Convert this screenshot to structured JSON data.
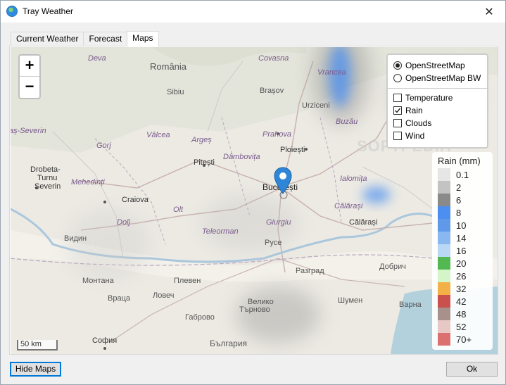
{
  "window": {
    "title": "Tray Weather",
    "close": "✕"
  },
  "icons": {
    "app": "globe-icon",
    "close": "close-icon",
    "pin": "map-pin-icon"
  },
  "tabs": [
    {
      "label": "Current Weather",
      "active": false
    },
    {
      "label": "Forecast",
      "active": false
    },
    {
      "label": "Maps",
      "active": true
    }
  ],
  "zoom": {
    "in": "+",
    "out": "−"
  },
  "layers": {
    "base": [
      {
        "label": "OpenStreetMap",
        "selected": true
      },
      {
        "label": "OpenStreetMap BW",
        "selected": false
      }
    ],
    "overlays": [
      {
        "label": "Temperature",
        "checked": false
      },
      {
        "label": "Rain",
        "checked": true
      },
      {
        "label": "Clouds",
        "checked": false
      },
      {
        "label": "Wind",
        "checked": false
      }
    ]
  },
  "legend": {
    "title": "Rain (mm)",
    "items": [
      {
        "label": "0.1",
        "color": "#e6e6e6"
      },
      {
        "label": "2",
        "color": "#c3c3c3"
      },
      {
        "label": "6",
        "color": "#8a8a8a"
      },
      {
        "label": "8",
        "color": "#4c8ff0"
      },
      {
        "label": "10",
        "color": "#5f99e8"
      },
      {
        "label": "14",
        "color": "#89b8f0"
      },
      {
        "label": "16",
        "color": "#b8d8f5"
      },
      {
        "label": "20",
        "color": "#54b852"
      },
      {
        "label": "26",
        "color": "#d4f5c8"
      },
      {
        "label": "32",
        "color": "#f2b046"
      },
      {
        "label": "42",
        "color": "#c9504d"
      },
      {
        "label": "48",
        "color": "#a8918a"
      },
      {
        "label": "52",
        "color": "#e8c8c5"
      },
      {
        "label": "70+",
        "color": "#dc6f70"
      }
    ]
  },
  "scale": "50 km",
  "map_labels": [
    {
      "text": "Deva",
      "color": "#7a5a8e",
      "italic": true
    },
    {
      "text": "Covasna",
      "color": "#7a5a8e",
      "italic": true
    },
    {
      "text": "România",
      "color": "#555",
      "italic": false
    },
    {
      "text": "Brașov",
      "color": "#555",
      "italic": false
    },
    {
      "text": "Vrancea",
      "color": "#7a5a8e",
      "italic": true
    },
    {
      "text": "Sibiu",
      "color": "#555",
      "italic": false
    },
    {
      "text": "Urziceni",
      "color": "#555",
      "italic": false
    },
    {
      "text": "Buzău",
      "color": "#7a5a8e",
      "italic": true
    },
    {
      "text": "aș-Severin",
      "color": "#7a5a8e",
      "italic": true
    },
    {
      "text": "Vâlcea",
      "color": "#7a5a8e",
      "italic": true
    },
    {
      "text": "Argeș",
      "color": "#7a5a8e",
      "italic": true
    },
    {
      "text": "Prahova",
      "color": "#7a5a8e",
      "italic": true
    },
    {
      "text": "Gorj",
      "color": "#7a5a8e",
      "italic": true
    },
    {
      "text": "Ploiești",
      "color": "#333",
      "italic": false
    },
    {
      "text": "Dâmbovița",
      "color": "#7a5a8e",
      "italic": true
    },
    {
      "text": "Pitești",
      "color": "#333",
      "italic": false
    },
    {
      "text": "Drobeta-",
      "color": "#333",
      "italic": false
    },
    {
      "text": "Turnu",
      "color": "#333",
      "italic": false
    },
    {
      "text": "Severin",
      "color": "#333",
      "italic": false
    },
    {
      "text": "Mehedinți",
      "color": "#7a5a8e",
      "italic": true
    },
    {
      "text": "Ialomița",
      "color": "#7a5a8e",
      "italic": true
    },
    {
      "text": "București",
      "color": "#222",
      "italic": false
    },
    {
      "text": "Craiova",
      "color": "#333",
      "italic": false
    },
    {
      "text": "Olt",
      "color": "#7a5a8e",
      "italic": true
    },
    {
      "text": "Călărași",
      "color": "#7a5a8e",
      "italic": true
    },
    {
      "text": "Dolj",
      "color": "#7a5a8e",
      "italic": true
    },
    {
      "text": "Giurgiu",
      "color": "#7a5a8e",
      "italic": true
    },
    {
      "text": "Călărași",
      "color": "#333",
      "italic": false
    },
    {
      "text": "Teleorman",
      "color": "#7a5a8e",
      "italic": true
    },
    {
      "text": "Видин",
      "color": "#555",
      "italic": false
    },
    {
      "text": "Русе",
      "color": "#555",
      "italic": false
    },
    {
      "text": "Разград",
      "color": "#555",
      "italic": false
    },
    {
      "text": "Добрич",
      "color": "#555",
      "italic": false
    },
    {
      "text": "Монтана",
      "color": "#555",
      "italic": false
    },
    {
      "text": "Плевен",
      "color": "#555",
      "italic": false
    },
    {
      "text": "Ловеч",
      "color": "#555",
      "italic": false
    },
    {
      "text": "Враца",
      "color": "#555",
      "italic": false
    },
    {
      "text": "Велико",
      "color": "#555",
      "italic": false
    },
    {
      "text": "Търново",
      "color": "#555",
      "italic": false
    },
    {
      "text": "Шумен",
      "color": "#555",
      "italic": false
    },
    {
      "text": "Варна",
      "color": "#555",
      "italic": false
    },
    {
      "text": "Габрово",
      "color": "#555",
      "italic": false
    },
    {
      "text": "София",
      "color": "#333",
      "italic": false
    },
    {
      "text": "България",
      "color": "#555",
      "italic": false
    }
  ],
  "buttons": {
    "hide_maps": "Hide Maps",
    "ok": "Ok"
  },
  "watermark": "SOFTPEDIA"
}
